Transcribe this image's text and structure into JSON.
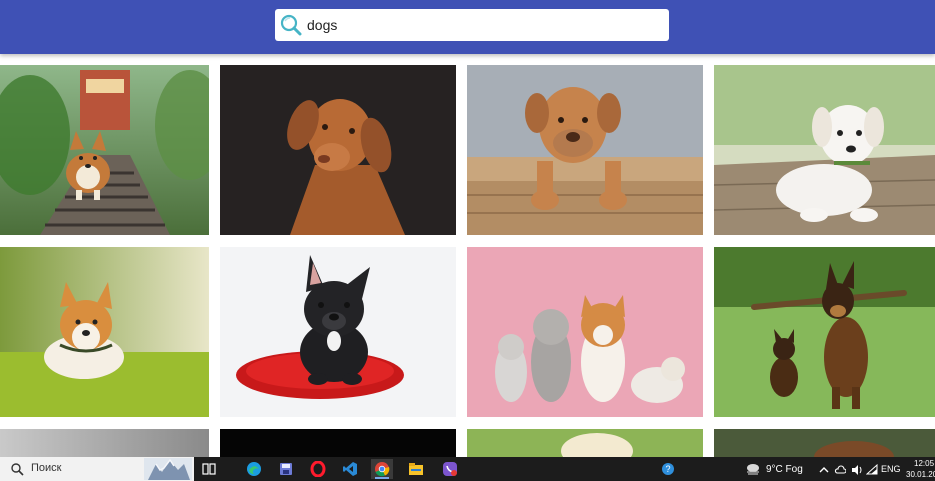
{
  "search": {
    "query": "dogs",
    "icon": "search-icon"
  },
  "gallery": {
    "photos": [
      {
        "subject": "corgi running on railway tracks"
      },
      {
        "subject": "vizsla dog tilting head on dark background"
      },
      {
        "subject": "dogue de bordeaux puppy in wooden crate"
      },
      {
        "subject": "white labrador puppy on wooden deck"
      },
      {
        "subject": "corgi lying in grass"
      },
      {
        "subject": "french bulldog on red cushion"
      },
      {
        "subject": "cats, poodle and corgi on pink background"
      },
      {
        "subject": "german shepherd with puppy carrying stick"
      }
    ]
  },
  "taskbar": {
    "search_placeholder": "Поиск",
    "weather": "9°C  Fog",
    "language": "ENG",
    "time": "12:05",
    "date": "30.01.20",
    "apps": [
      "task-view-icon",
      "edge-icon",
      "save-icon",
      "opera-icon",
      "vscode-icon",
      "chrome-icon",
      "file-explorer-icon",
      "viber-icon"
    ],
    "colors": {
      "accent": "#3f51b5",
      "taskbar": "#1c1c1c"
    }
  }
}
